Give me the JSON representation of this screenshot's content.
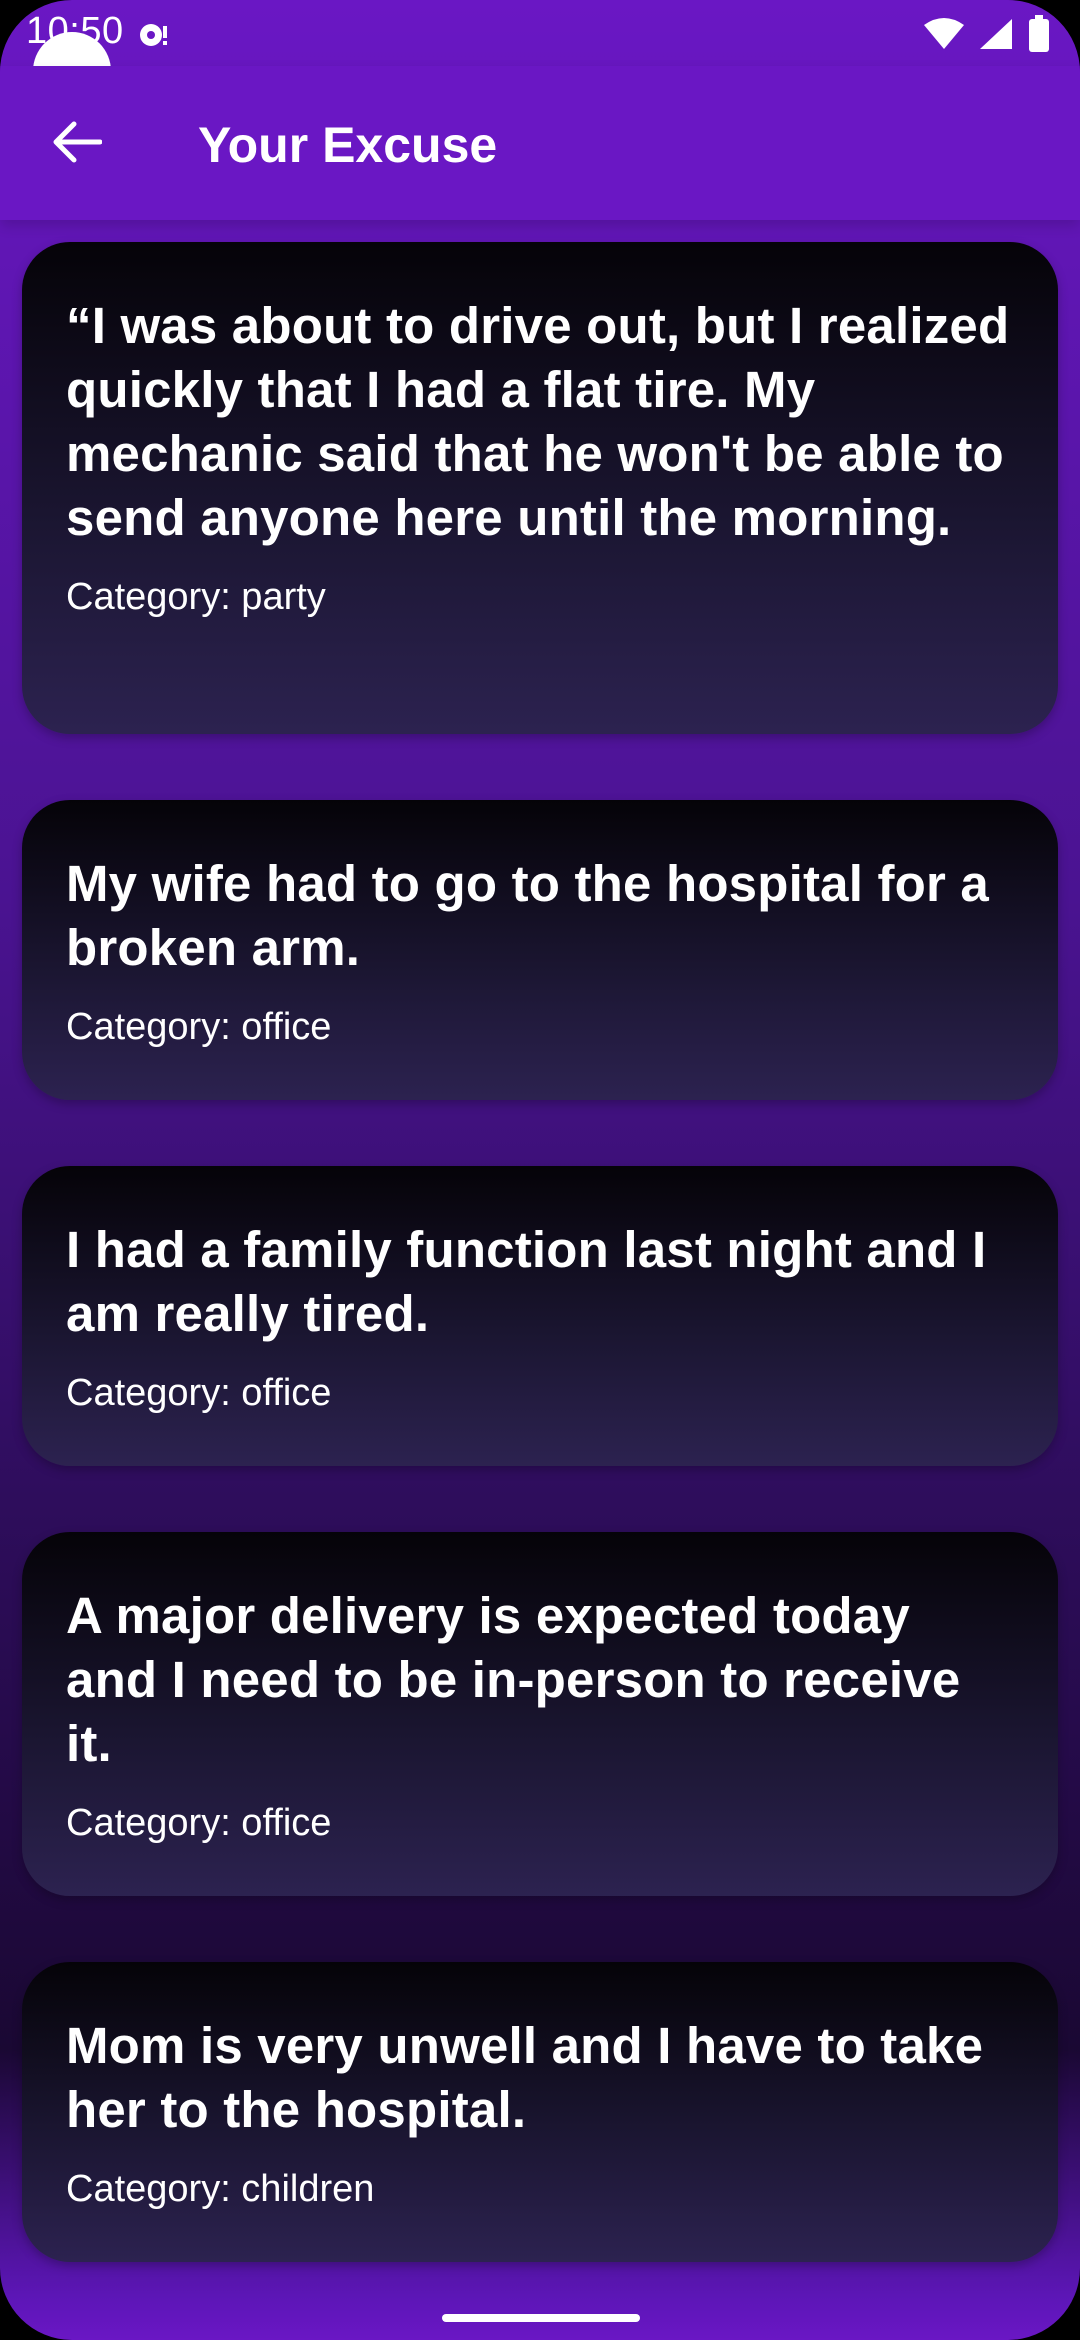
{
  "status_bar": {
    "time": "10:50",
    "icons": [
      "notification-icon",
      "wifi-icon",
      "signal-icon",
      "battery-icon"
    ]
  },
  "app_bar": {
    "back_icon": "arrow-back-icon",
    "title": "Your Excuse"
  },
  "excuses": [
    {
      "text": "“I was about to drive out, but I realized quickly that I had a flat tire. My mechanic said that he won't be able to send anyone here until the morning.",
      "category": "Category: party"
    },
    {
      "text": "My wife had to go to the hospital for a broken arm.",
      "category": "Category: office"
    },
    {
      "text": "I had a family function last night and I am really tired.",
      "category": "Category: office"
    },
    {
      "text": "A major delivery is expected today and I need to be in-person to receive it.",
      "category": "Category: office"
    },
    {
      "text": "Mom is very unwell and I have to take her to the hospital.",
      "category": "Category: children"
    }
  ],
  "colors": {
    "app_bar": "#6a17c4",
    "card_top": "#050308",
    "card_bottom": "#2c2250",
    "text": "#ffffff"
  }
}
